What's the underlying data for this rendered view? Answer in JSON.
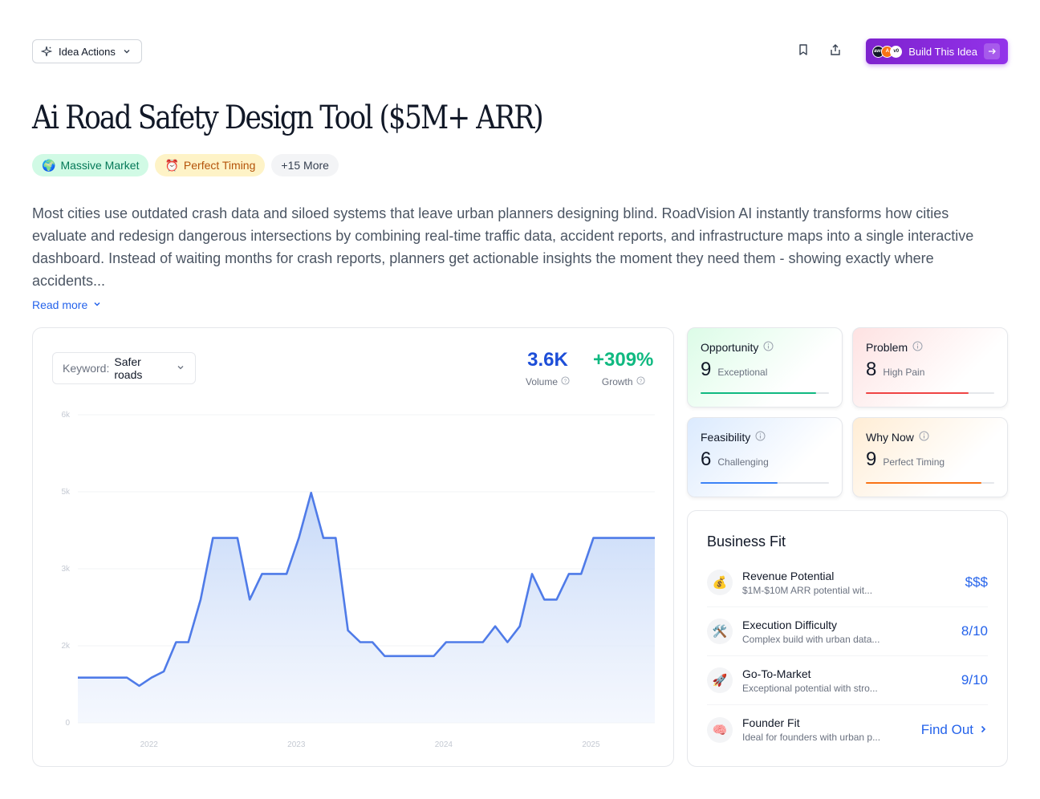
{
  "header": {
    "idea_actions_label": "Idea Actions",
    "build_label": "Build This Idea",
    "logo_dots": [
      "aws",
      "A",
      "v0"
    ]
  },
  "title": "Ai Road Safety Design Tool ($5M+ ARR)",
  "tags": [
    {
      "emoji": "🌍",
      "label": "Massive Market"
    },
    {
      "emoji": "⏰",
      "label": "Perfect Timing"
    },
    {
      "emoji": "",
      "label": "+15 More"
    }
  ],
  "description": "Most cities use outdated crash data and siloed systems that leave urban planners designing blind. RoadVision AI instantly transforms how cities evaluate and redesign dangerous intersections by combining real-time traffic data, accident reports, and infrastructure maps into a single interactive dashboard. Instead of waiting months for crash reports, planners get actionable insights the moment they need them - showing exactly where accidents...",
  "read_more_label": "Read more",
  "trend": {
    "keyword_label": "Keyword:",
    "keyword_value": "Safer roads",
    "volume_value": "3.6K",
    "volume_label": "Volume",
    "growth_value": "+309%",
    "growth_label": "Growth"
  },
  "chart_data": {
    "type": "area",
    "title": "",
    "xlabel": "",
    "ylabel": "",
    "y_tick_labels": [
      "0",
      "2k",
      "3k",
      "5k",
      "6k"
    ],
    "x_tick_labels": [
      "2022",
      "2023",
      "2024",
      "2025"
    ],
    "x_tick_positions": [
      5.8,
      17.8,
      29.8,
      41.8
    ],
    "ylim": [
      0,
      6000
    ],
    "xlim": [
      0,
      47
    ],
    "x": [
      0,
      1,
      2,
      3,
      4,
      5,
      6,
      7,
      8,
      9,
      10,
      11,
      12,
      13,
      14,
      15,
      16,
      17,
      18,
      19,
      20,
      21,
      22,
      23,
      24,
      25,
      26,
      27,
      28,
      29,
      30,
      31,
      32,
      33,
      34,
      35,
      36,
      37,
      38,
      39,
      40,
      41,
      42,
      43,
      44,
      45,
      46,
      47
    ],
    "values": [
      880,
      880,
      880,
      880,
      880,
      720,
      880,
      1000,
      1570,
      1570,
      2400,
      3600,
      3600,
      3600,
      2400,
      2900,
      2900,
      2900,
      3600,
      4480,
      3600,
      3600,
      1800,
      1570,
      1570,
      1300,
      1300,
      1300,
      1300,
      1300,
      1570,
      1570,
      1570,
      1570,
      1880,
      1570,
      1880,
      2900,
      2400,
      2400,
      2900,
      2900,
      3600,
      3600,
      3600,
      3600,
      3600,
      3600
    ],
    "grid": true,
    "color": "#4f7be8"
  },
  "scores": [
    {
      "label": "Opportunity",
      "value": "9",
      "text": "Exceptional",
      "fill": 0.9,
      "color": "#10b981"
    },
    {
      "label": "Problem",
      "value": "8",
      "text": "High Pain",
      "fill": 0.8,
      "color": "#ef4444"
    },
    {
      "label": "Feasibility",
      "value": "6",
      "text": "Challenging",
      "fill": 0.6,
      "color": "#3b82f6"
    },
    {
      "label": "Why Now",
      "value": "9",
      "text": "Perfect Timing",
      "fill": 0.9,
      "color": "#f97316"
    }
  ],
  "business_fit": {
    "title": "Business Fit",
    "rows": [
      {
        "emoji": "💰",
        "name": "Revenue Potential",
        "sub": "$1M-$10M ARR potential wit...",
        "value": "$$$"
      },
      {
        "emoji": "🛠️",
        "name": "Execution Difficulty",
        "sub": "Complex build with urban data...",
        "value": "8/10"
      },
      {
        "emoji": "🚀",
        "name": "Go-To-Market",
        "sub": "Exceptional potential with stro...",
        "value": "9/10"
      },
      {
        "emoji": "🧠",
        "name": "Founder Fit",
        "sub": "Ideal for founders with urban p...",
        "value": "Find Out"
      }
    ]
  }
}
